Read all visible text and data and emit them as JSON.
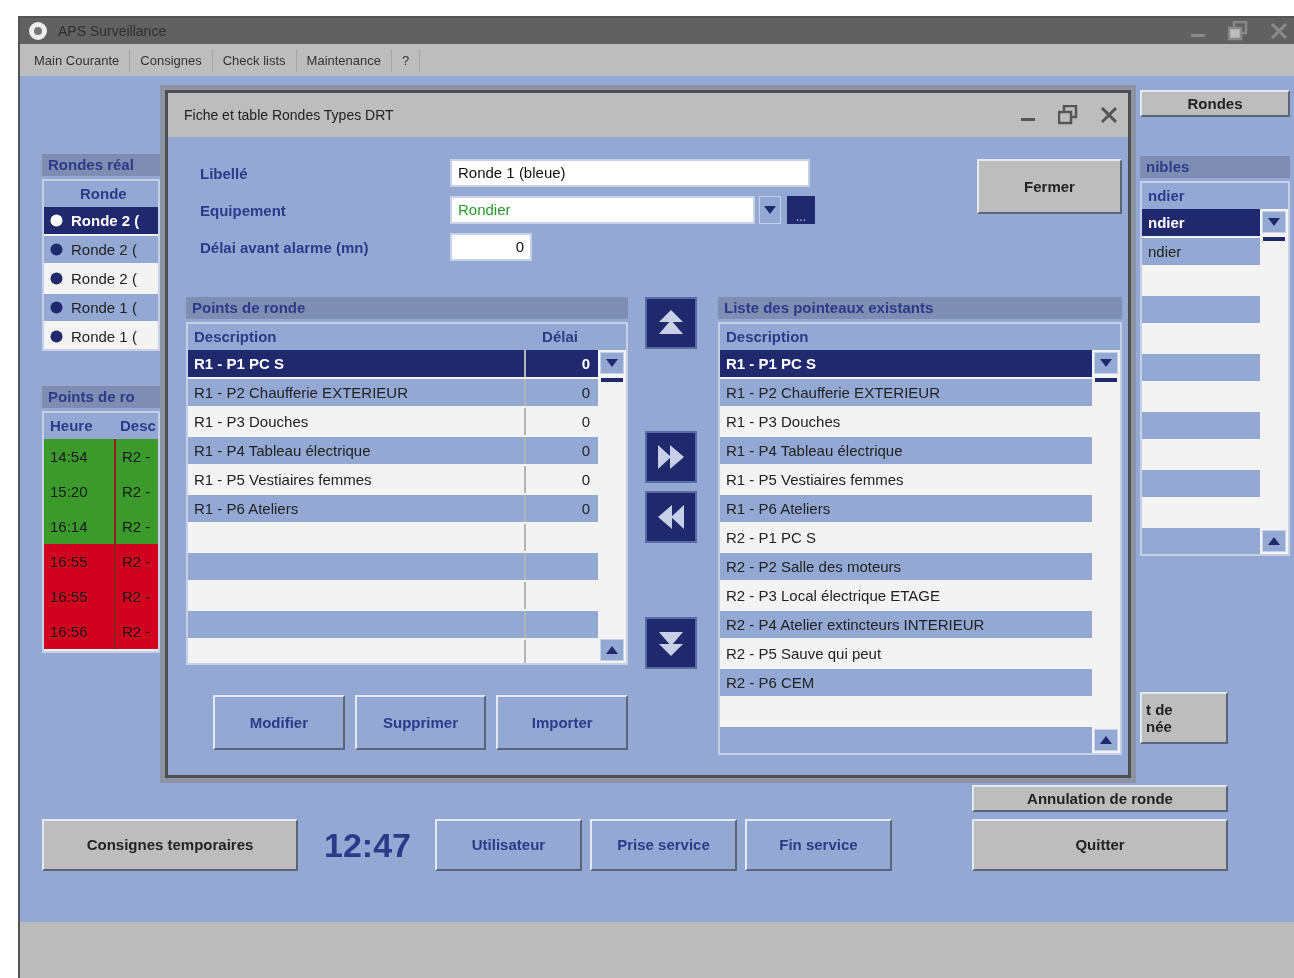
{
  "window": {
    "title": "APS Surveillance"
  },
  "menu": [
    "Main Courante",
    "Consignes",
    "Check lists",
    "Maintenance",
    "?"
  ],
  "background": {
    "rondes_button": "Rondes",
    "rondes_realisees": {
      "title": "Rondes réal",
      "column": "Ronde",
      "rows": [
        {
          "label": "Ronde 2 (",
          "selected": true
        },
        {
          "label": "Ronde 2 (",
          "selected": false
        },
        {
          "label": "Ronde 2 (",
          "selected": false
        },
        {
          "label": "Ronde 1 (",
          "selected": false
        },
        {
          "label": "Ronde 1 (",
          "selected": false
        }
      ]
    },
    "points_de_ronde": {
      "title": "Points de ro",
      "columns": [
        "Heure",
        "Desc"
      ],
      "rows": [
        {
          "time": "14:54",
          "description": "R2 -",
          "color": "#3c9a2c"
        },
        {
          "time": "15:20",
          "description": "R2 -",
          "color": "#3c9a2c"
        },
        {
          "time": "16:14",
          "description": "R2 -",
          "color": "#3c9a2c"
        },
        {
          "time": "16:55",
          "description": "R2 -",
          "color": "#d0001e"
        },
        {
          "time": "16:55",
          "description": "R2 -",
          "color": "#d0001e"
        },
        {
          "time": "16:56",
          "description": "R2 -",
          "color": "#d0001e"
        }
      ]
    },
    "disponibles": {
      "title": "nibles",
      "column": "ndier",
      "rows": [
        {
          "label": "ndier",
          "selected": true
        },
        {
          "label": "ndier",
          "selected": false
        }
      ]
    },
    "edition_button_lines": [
      "t de",
      "née"
    ],
    "cancel_button": "Annulation de ronde",
    "quit_button": "Quitter",
    "bottom_bar": {
      "consignes_button": "Consignes temporaires",
      "clock": "12:47",
      "buttons": [
        "Utilisateur",
        "Prise service",
        "Fin service"
      ]
    }
  },
  "dialog": {
    "title": "Fiche et table Rondes Types DRT",
    "fields": [
      {
        "kind": "text",
        "label": "Libellé",
        "value": "Ronde 1 (bleue)"
      },
      {
        "kind": "dropdown",
        "label": "Equipement",
        "value": "Rondier",
        "browse_button": "..."
      },
      {
        "kind": "number",
        "label": "Délai avant alarme (mn)",
        "value": "0"
      }
    ],
    "close_button": "Fermer",
    "points": {
      "title": "Points de ronde",
      "columns": [
        "Description",
        "Délai"
      ],
      "rows": [
        {
          "description": "R1 - P1 PC S",
          "delay": "0",
          "selected": true
        },
        {
          "description": "R1 - P2 Chaufferie EXTERIEUR",
          "delay": "0",
          "selected": false
        },
        {
          "description": "R1 - P3 Douches",
          "delay": "0",
          "selected": false
        },
        {
          "description": "R1 - P4 Tableau électrique",
          "delay": "0",
          "selected": false
        },
        {
          "description": "R1 - P5 Vestiaires femmes",
          "delay": "0",
          "selected": false
        },
        {
          "description": "R1 - P6 Ateliers",
          "delay": "0",
          "selected": false
        }
      ]
    },
    "pointeaux": {
      "title": "Liste des pointeaux existants",
      "column": "Description",
      "rows": [
        {
          "description": "R1 - P1 PC S",
          "selected": true
        },
        {
          "description": "R1 - P2 Chaufferie EXTERIEUR",
          "selected": false
        },
        {
          "description": "R1 - P3 Douches",
          "selected": false
        },
        {
          "description": "R1 - P4 Tableau électrique",
          "selected": false
        },
        {
          "description": "R1 - P5 Vestiaires femmes",
          "selected": false
        },
        {
          "description": "R1 - P6 Ateliers",
          "selected": false
        },
        {
          "description": "R2 - P1 PC S",
          "selected": false
        },
        {
          "description": "R2 - P2 Salle des moteurs",
          "selected": false
        },
        {
          "description": "R2 - P3 Local électrique ETAGE",
          "selected": false
        },
        {
          "description": "R2 - P4 Atelier extincteurs INTERIEUR",
          "selected": false
        },
        {
          "description": "R2 - P5 Sauve qui peut",
          "selected": false
        },
        {
          "description": "R2 - P6 CEM",
          "selected": false
        }
      ]
    },
    "buttons": [
      "Modifier",
      "Supprimer",
      "Importer"
    ]
  }
}
